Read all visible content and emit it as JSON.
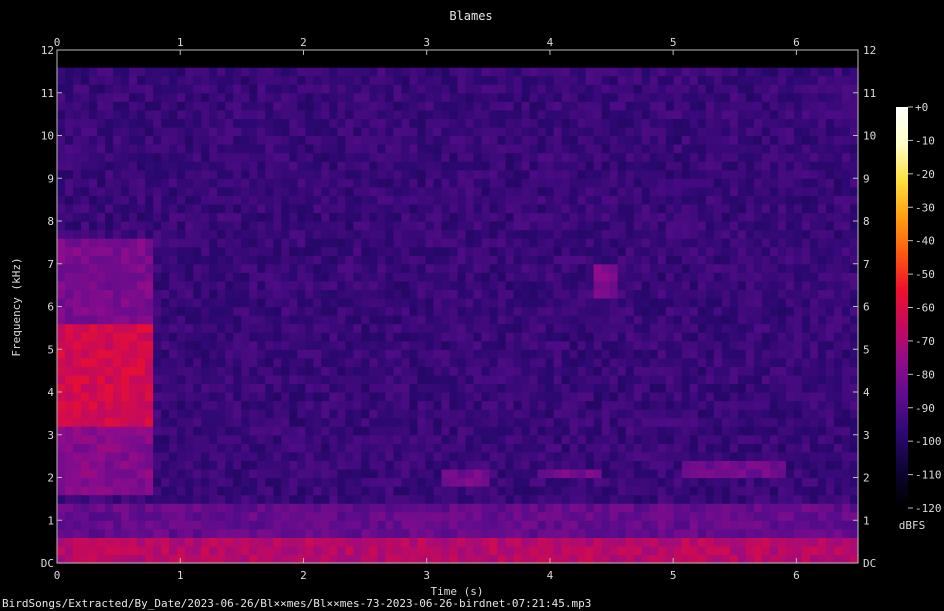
{
  "chart_data": {
    "type": "heatmap",
    "title": "Blames",
    "xlabel": "Time (s)",
    "ylabel": "Frequency (kHz)",
    "xlim": [
      0,
      6.5
    ],
    "ylim": [
      0,
      12
    ],
    "x_ticks": [
      {
        "value": 0,
        "label": "0"
      },
      {
        "value": 1,
        "label": "1"
      },
      {
        "value": 2,
        "label": "2"
      },
      {
        "value": 3,
        "label": "3"
      },
      {
        "value": 4,
        "label": "4"
      },
      {
        "value": 5,
        "label": "5"
      },
      {
        "value": 6,
        "label": "6"
      }
    ],
    "y_ticks": [
      {
        "value": 0,
        "label": "DC"
      },
      {
        "value": 1,
        "label": "1"
      },
      {
        "value": 2,
        "label": "2"
      },
      {
        "value": 3,
        "label": "3"
      },
      {
        "value": 4,
        "label": "4"
      },
      {
        "value": 5,
        "label": "5"
      },
      {
        "value": 6,
        "label": "6"
      },
      {
        "value": 7,
        "label": "7"
      },
      {
        "value": 8,
        "label": "8"
      },
      {
        "value": 9,
        "label": "9"
      },
      {
        "value": 10,
        "label": "10"
      },
      {
        "value": 11,
        "label": "11"
      },
      {
        "value": 12,
        "label": "12"
      }
    ],
    "colorbar": {
      "unit": "dBFS",
      "range": [
        -120,
        0
      ],
      "ticks": [
        {
          "value": 0,
          "label": "+0"
        },
        {
          "value": -10,
          "label": "-10"
        },
        {
          "value": -20,
          "label": "-20"
        },
        {
          "value": -30,
          "label": "-30"
        },
        {
          "value": -40,
          "label": "-40"
        },
        {
          "value": -50,
          "label": "-50"
        },
        {
          "value": -60,
          "label": "-60"
        },
        {
          "value": -70,
          "label": "-70"
        },
        {
          "value": -80,
          "label": "-80"
        },
        {
          "value": -90,
          "label": "-90"
        },
        {
          "value": -100,
          "label": "-100"
        },
        {
          "value": -110,
          "label": "-110"
        },
        {
          "value": -120,
          "label": "-120"
        }
      ],
      "colors": [
        "#000000",
        "#0d0430",
        "#2a0870",
        "#5a0c8c",
        "#8c0c8c",
        "#c40a5c",
        "#f0102a",
        "#ff5a10",
        "#ffa010",
        "#ffe040",
        "#ffffc8",
        "#ffffff"
      ]
    },
    "noise_floor_dbfs": -95,
    "bandwidth_khz": 11.5,
    "regions": [
      {
        "t": [
          0.0,
          6.5
        ],
        "f": [
          0.0,
          0.6
        ],
        "dbfs": -68
      },
      {
        "t": [
          0.0,
          6.5
        ],
        "f": [
          0.6,
          1.3
        ],
        "dbfs": -85
      },
      {
        "t": [
          0.0,
          0.8
        ],
        "f": [
          3.3,
          5.6
        ],
        "dbfs": -62
      },
      {
        "t": [
          0.0,
          0.8
        ],
        "f": [
          1.6,
          3.3
        ],
        "dbfs": -78
      },
      {
        "t": [
          0.0,
          0.8
        ],
        "f": [
          5.6,
          7.5
        ],
        "dbfs": -80
      },
      {
        "t": [
          4.35,
          4.55
        ],
        "f": [
          6.2,
          7.1
        ],
        "dbfs": -80
      },
      {
        "t": [
          3.1,
          3.5
        ],
        "f": [
          1.8,
          2.2
        ],
        "dbfs": -82
      },
      {
        "t": [
          3.9,
          4.4
        ],
        "f": [
          2.0,
          2.3
        ],
        "dbfs": -82
      },
      {
        "t": [
          5.1,
          5.9
        ],
        "f": [
          2.0,
          2.4
        ],
        "dbfs": -83
      }
    ]
  },
  "footer": {
    "path": "BirdSongs/Extracted/By_Date/2023-06-26/Bl××mes/Bl××mes-73-2023-06-26-birdnet-07:21:45.mp3"
  }
}
